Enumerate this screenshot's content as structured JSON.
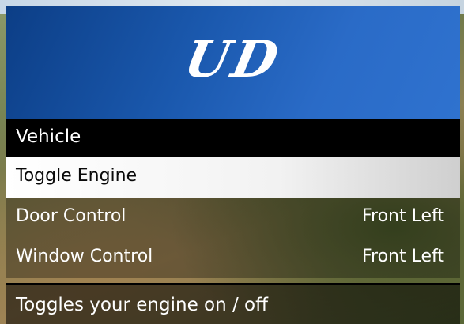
{
  "menu": {
    "banner_title": "UD",
    "subtitle": "Vehicle",
    "items": [
      {
        "label": "Toggle Engine",
        "value": ""
      },
      {
        "label": "Door Control",
        "value": "Front Left"
      },
      {
        "label": "Window Control",
        "value": "Front Left"
      }
    ],
    "description": "Toggles your engine on / off"
  },
  "colors": {
    "banner": "#1a58ad",
    "subtitle_bg": "#000000",
    "selected_bg": "#ffffff"
  }
}
